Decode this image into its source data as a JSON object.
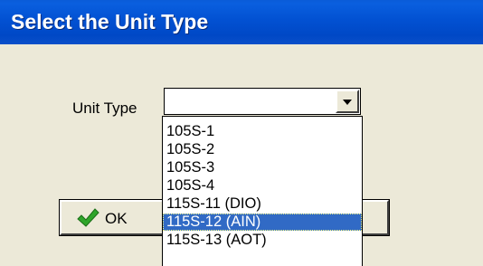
{
  "dialog": {
    "title": "Select the Unit Type"
  },
  "unit_type": {
    "label": "Unit Type",
    "value": "",
    "options": [
      "105S-1",
      "105S-2",
      "105S-3",
      "105S-4",
      "115S-11 (DIO)",
      "115S-12 (AIN)",
      "115S-13 (AOT)"
    ],
    "selected_index": 5
  },
  "buttons": {
    "ok_label": "OK",
    "ok_icon": "green-checkmark-icon"
  },
  "colors": {
    "title_bar": "#0251d2",
    "selection": "#316ac5",
    "dialog_bg": "#ece9d8"
  }
}
